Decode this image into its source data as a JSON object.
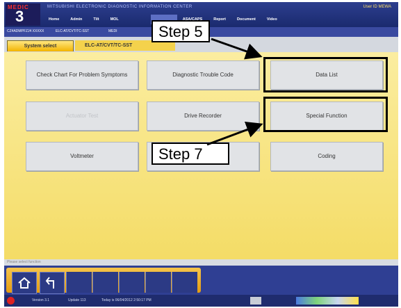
{
  "app": {
    "brand": "MEDIC",
    "version_badge": "3",
    "title": "MITSUBISHI ELECTRONIC DIAGNOSTIC INFORMATION CENTER",
    "user": "User ID MEWA"
  },
  "menu": [
    "Home",
    "Admin",
    "Tilt",
    "MOL",
    "",
    "",
    "ASA/CAPS",
    "Report",
    "Document",
    "Video"
  ],
  "breadcrumb": [
    "CZ4ADMPFZJ4 XXXXX",
    "ELC-AT/CVT/TC-SST",
    "MEDI"
  ],
  "tabs": {
    "system_select": "System select",
    "current": "ELC-AT/CVT/TC-SST"
  },
  "functions": [
    {
      "label": "Check Chart For Problem Symptoms"
    },
    {
      "label": "Diagnostic Trouble Code"
    },
    {
      "label": "Data List"
    },
    {
      "label": "Actuator Test"
    },
    {
      "label": "Drive Recorder"
    },
    {
      "label": "Special Function"
    },
    {
      "label": "Voltmeter"
    },
    {
      "label": ""
    },
    {
      "label": "Coding"
    }
  ],
  "status_message": "Please select function",
  "footer": {
    "version": "Version 3.1",
    "update": "Update 113",
    "today": "Today is 06/04/2012 2:50:17 PM"
  },
  "callouts": {
    "step5": "Step 5",
    "step7": "Step 7"
  },
  "icons": {
    "home": "home-icon",
    "back": "back-arrow-icon"
  }
}
